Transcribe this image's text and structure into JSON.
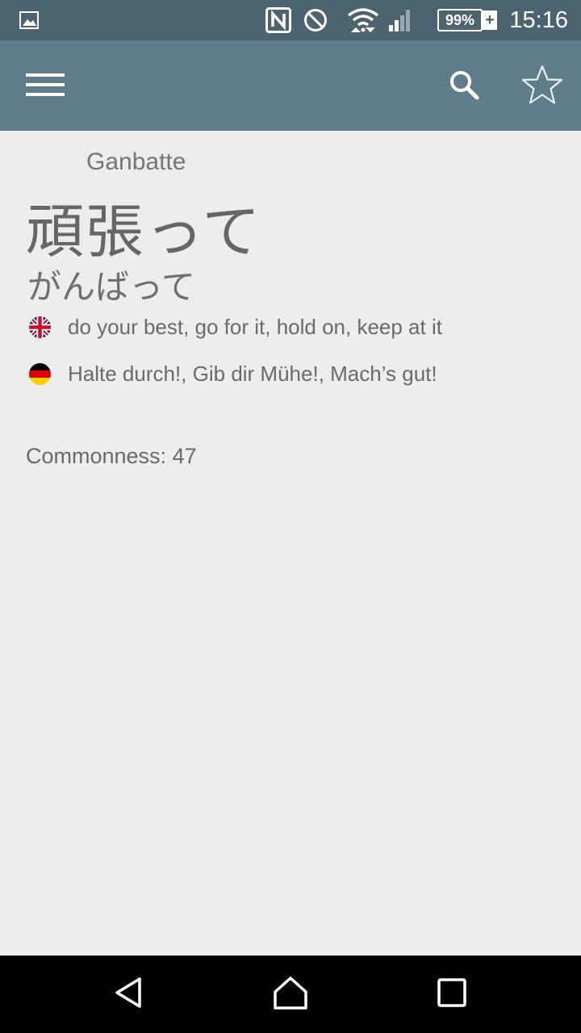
{
  "status_bar": {
    "icons": [
      "image-notification-icon",
      "nfc-icon",
      "do-not-disturb-icon",
      "wifi-icon",
      "cell-signal-icon",
      "battery-charging-icon"
    ],
    "battery": "99%",
    "battery_plus": "+",
    "time": "15:16"
  },
  "app_bar": {
    "icons": [
      "menu-icon",
      "search-icon",
      "star-outline-icon"
    ],
    "color": "#607d8b"
  },
  "entry": {
    "romaji": "Ganbatte",
    "kanji": "頑張って",
    "kana": "がんばって",
    "meanings": [
      {
        "flag": "uk-flag-icon",
        "text": "do your best, go for it, hold on, keep at it"
      },
      {
        "flag": "germany-flag-icon",
        "text": "Halte durch!, Gib dir Mühe!, Mach’s gut!"
      }
    ],
    "commonness": "Commonness: 47"
  },
  "nav_bar": {
    "icons": [
      "back-icon",
      "home-icon",
      "recents-icon"
    ]
  }
}
